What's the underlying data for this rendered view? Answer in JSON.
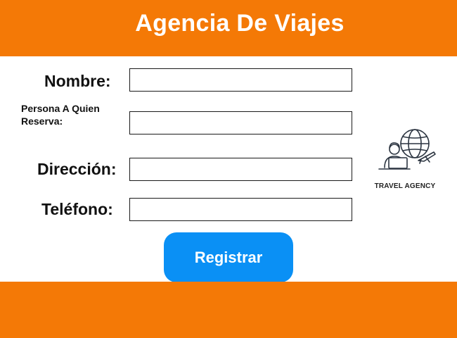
{
  "header": {
    "title": "Agencia De Viajes"
  },
  "form": {
    "name_label": "Nombre:",
    "name_value": "",
    "reserver_label": "Persona A Quien Reserva:",
    "reserver_value": "",
    "address_label": "Dirección:",
    "address_value": "",
    "phone_label": "Teléfono:",
    "phone_value": "",
    "submit_label": "Registrar"
  },
  "logo": {
    "caption": "TRAVEL AGENCY",
    "icon": "travel-agent-globe-icon"
  },
  "colors": {
    "brand": "#f47906",
    "accent": "#0a90f5"
  }
}
